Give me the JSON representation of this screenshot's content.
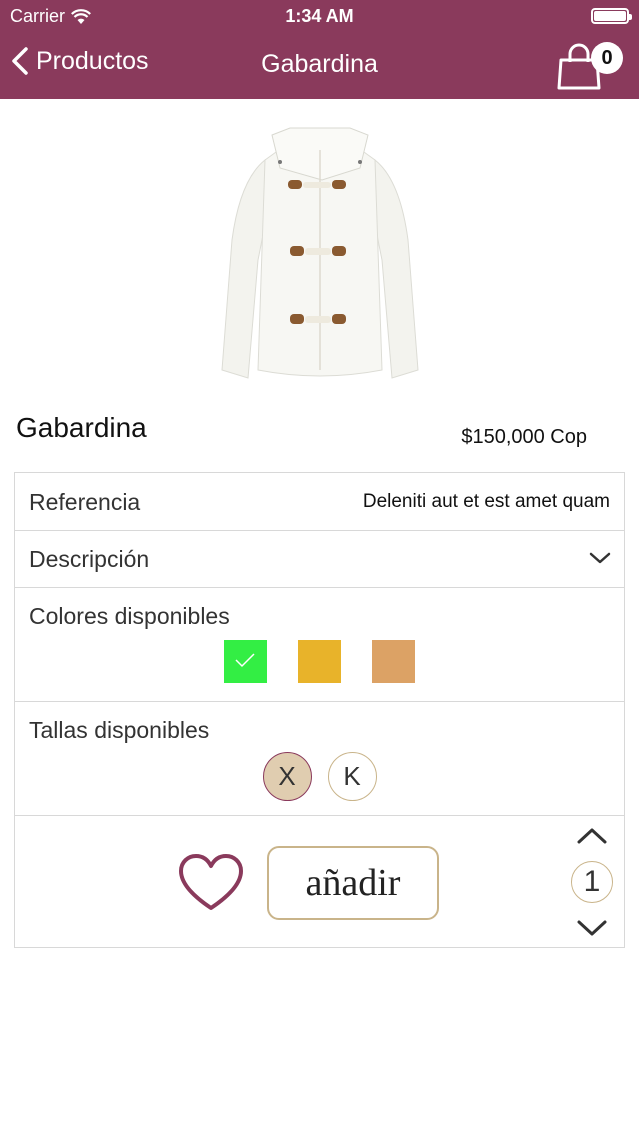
{
  "status": {
    "carrier": "Carrier",
    "time": "1:34 AM"
  },
  "nav": {
    "back_label": "Productos",
    "title": "Gabardina",
    "cart_count": "0"
  },
  "product": {
    "name": "Gabardina",
    "price": "$150,000 Cop",
    "image_icon": "white-jacket-image"
  },
  "details": {
    "reference_label": "Referencia",
    "reference_value": "Deleniti aut et est amet quam",
    "description_label": "Descripción",
    "colors_label": "Colores disponibles",
    "colors": [
      "#33ee44",
      "#e8b32a",
      "#dca265"
    ],
    "selected_color_index": 0,
    "sizes_label": "Tallas disponibles",
    "sizes": [
      "X",
      "K"
    ],
    "selected_size_index": 0
  },
  "actions": {
    "add_label": "añadir",
    "quantity": "1"
  },
  "theme": {
    "accent": "#8a3a5c",
    "gold": "#c9b48a"
  }
}
